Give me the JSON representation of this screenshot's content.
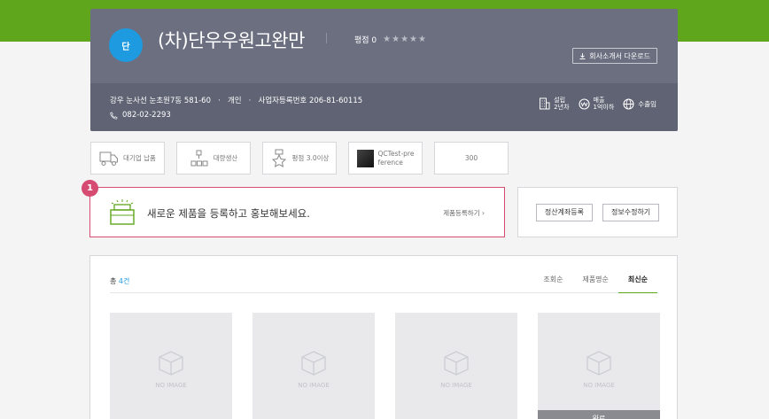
{
  "company": {
    "avatar_letter": "단",
    "name": "(차)단우우원고완만",
    "rating_label": "평점 0",
    "stars": "★★★★★",
    "download_label": "회사소개서 다운로드",
    "address": "강우 눈사선 눈초원7동 581-60",
    "business_type": "개인",
    "registration": "사업자등록번호 206-81-60115",
    "phone": "082-02-2293",
    "stats": {
      "founded": [
        "설립",
        "2년차"
      ],
      "sales": [
        "매출",
        "1억이하"
      ],
      "export": "수출임"
    }
  },
  "badges": {
    "large_supplier": "대기업 납품",
    "mass_production": "대량생산",
    "rating": "평점 3.0이상",
    "preference": [
      "QCTest-pre",
      "ference"
    ],
    "count": "300"
  },
  "register": {
    "marker": "1",
    "message": "새로운 제품을 등록하고 홍보해보세요.",
    "link": "제품등록하기 ›"
  },
  "actions": {
    "settlement": "정산계좌등록",
    "edit_info": "정보수정하기"
  },
  "products": {
    "total_prefix": "총 ",
    "total_count": "4건",
    "sort_tabs": [
      "조회순",
      "제품명순",
      "최신순"
    ],
    "no_image": "NO IMAGE",
    "sold_label": "완료"
  },
  "colors": {
    "brand_green": "#5fa61c",
    "card_gray": "#6b6f80",
    "highlight_pink": "#d54b71",
    "avatar_blue": "#1e9be0"
  }
}
